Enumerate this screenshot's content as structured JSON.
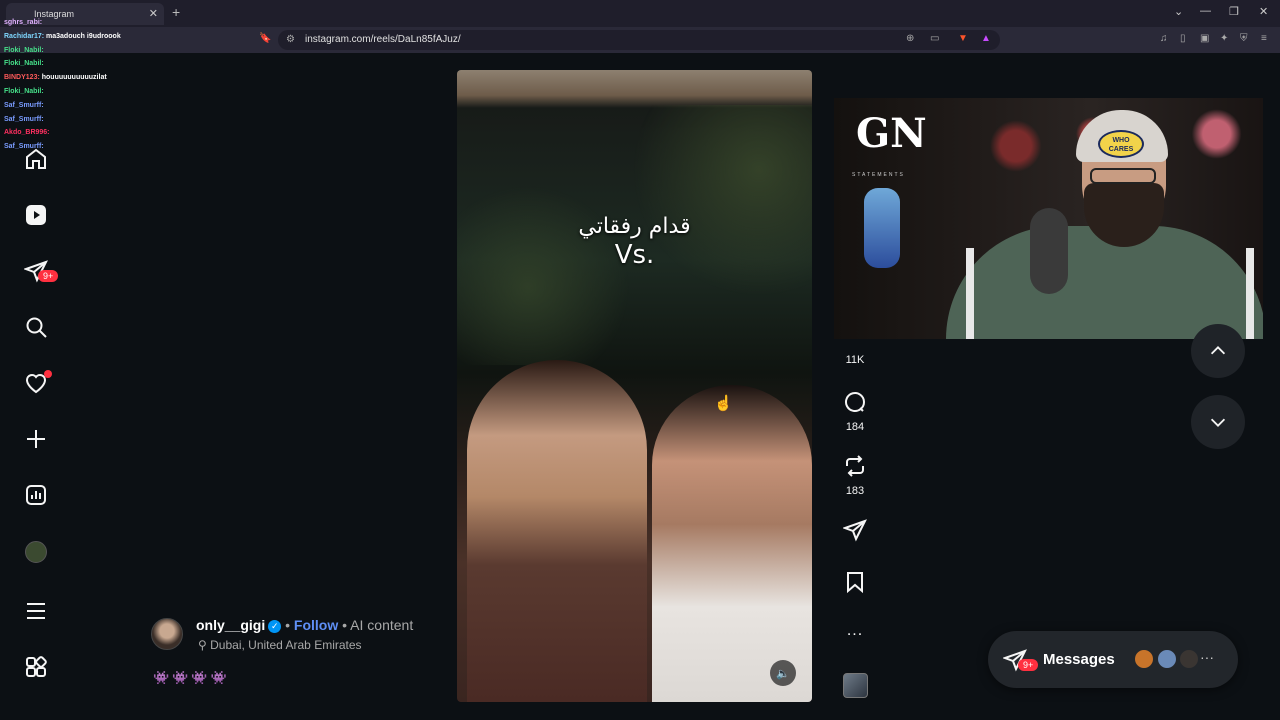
{
  "browser": {
    "tab_title": "Instagram",
    "new_tab": "+",
    "close_tab": "✕",
    "url": "instagram.com/reels/DaLn85fAJuz/"
  },
  "chat": [
    {
      "user": "sghrs_rabi:",
      "msg": "",
      "color": "#e0b0ff"
    },
    {
      "user": "Rachidar17:",
      "msg": "ma3adouch i9udroook",
      "color": "#7fd7ff"
    },
    {
      "user": "Floki_Nabil:",
      "msg": "",
      "color": "#46e08a"
    },
    {
      "user": "Floki_Nabil:",
      "msg": "",
      "color": "#46e08a"
    },
    {
      "user": "BINDY123:",
      "msg": "houuuuuuuuuuzilat",
      "color": "#ff5a5a"
    },
    {
      "user": "Floki_Nabil:",
      "msg": "",
      "color": "#46e08a"
    },
    {
      "user": "Saf_Smurff:",
      "msg": "",
      "color": "#7a9cff"
    },
    {
      "user": "Saf_Smurff:",
      "msg": "",
      "color": "#7a9cff"
    },
    {
      "user": "Akdo_BR996:",
      "msg": "",
      "color": "#ff3060"
    },
    {
      "user": "Saf_Smurff:",
      "msg": "",
      "color": "#7a9cff"
    }
  ],
  "nav": {
    "messages_badge": "9+"
  },
  "reel": {
    "caption_ar": "قدام رفقاتي",
    "caption_vs": "Vs."
  },
  "author": {
    "name": "only__gigi",
    "follow": "Follow",
    "separator": " • ",
    "ai_label": "AI content",
    "location": "Dubai, United Arab Emirates",
    "emojis": "👾👾👾👾"
  },
  "actions": {
    "likes": "11K",
    "comments": "184",
    "reposts": "183",
    "more": "..."
  },
  "webcam": {
    "logo": "GN",
    "logo_sub": "STATEMENTS",
    "cap_text": "WHO CARES"
  },
  "messages": {
    "label": "Messages",
    "badge": "9+",
    "more": "···"
  }
}
